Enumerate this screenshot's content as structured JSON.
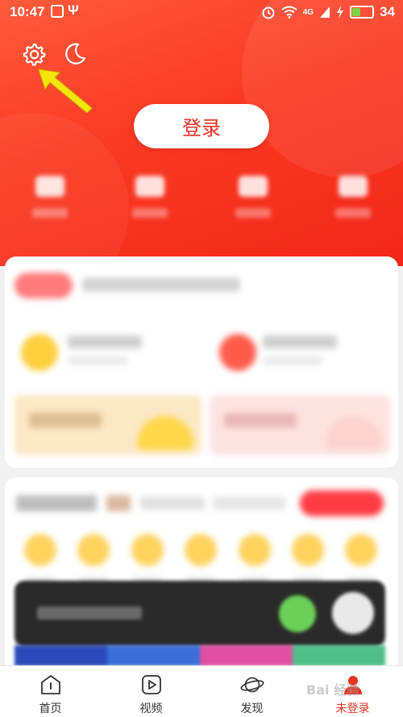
{
  "status_bar": {
    "time": "10:47",
    "network_label": "4G",
    "battery_level": "34",
    "battery_color": "#7cd64a"
  },
  "header": {
    "login_label": "登录",
    "settings_icon": "gear-icon",
    "night_mode_icon": "moon-icon",
    "annotation_color": "#f5e60a"
  },
  "bottom_nav": {
    "items": [
      {
        "label": "首页",
        "icon": "home-icon"
      },
      {
        "label": "视频",
        "icon": "play-icon"
      },
      {
        "label": "发现",
        "icon": "planet-icon"
      },
      {
        "label": "未登录",
        "icon": "profile-icon"
      }
    ],
    "active_index": 3
  },
  "watermark": "Bai 经验",
  "colors": {
    "brand_red": "#e8321f",
    "header_red": "#fa3a22",
    "background": "#f1f1f1"
  }
}
